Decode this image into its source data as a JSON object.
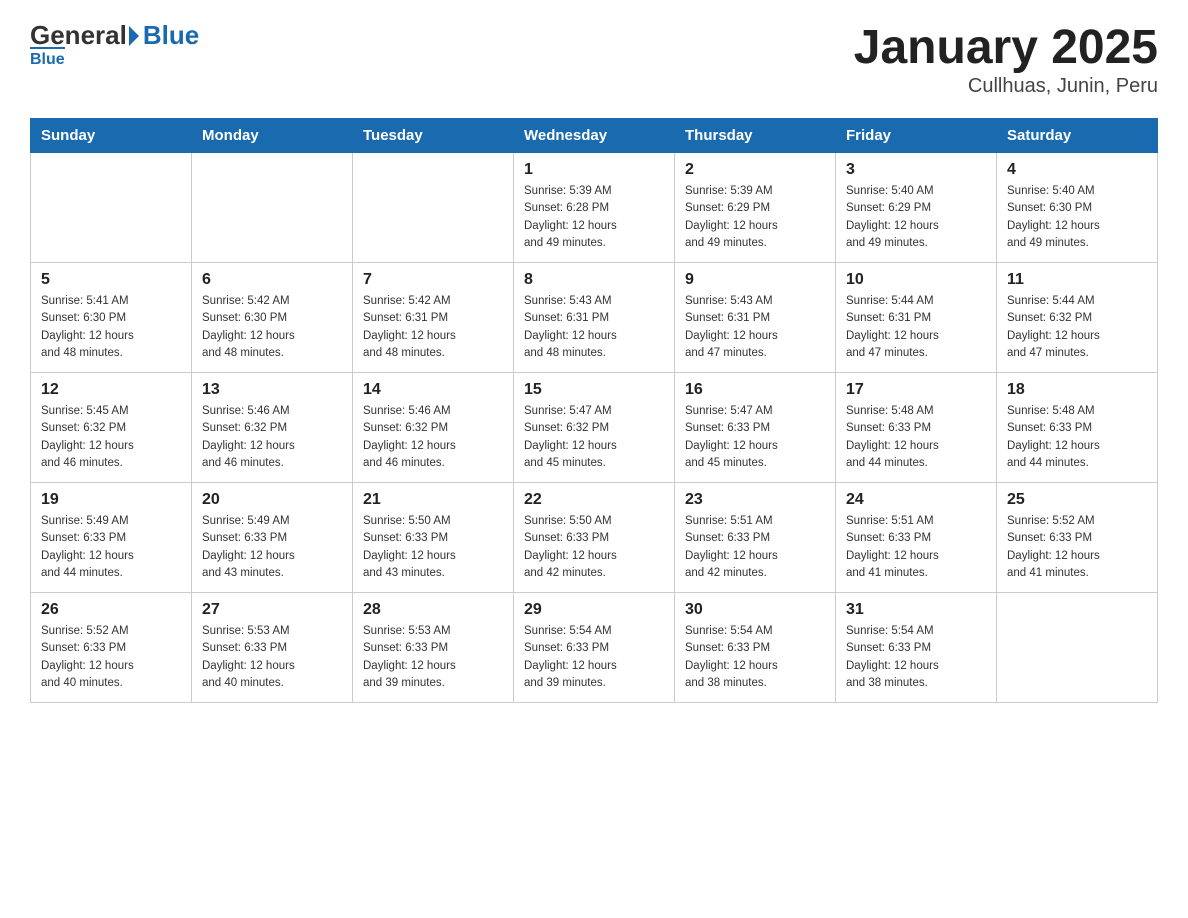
{
  "header": {
    "title": "January 2025",
    "subtitle": "Cullhuas, Junin, Peru",
    "logo_general": "General",
    "logo_blue": "Blue"
  },
  "days_of_week": [
    "Sunday",
    "Monday",
    "Tuesday",
    "Wednesday",
    "Thursday",
    "Friday",
    "Saturday"
  ],
  "weeks": [
    [
      {
        "day": "",
        "info": ""
      },
      {
        "day": "",
        "info": ""
      },
      {
        "day": "",
        "info": ""
      },
      {
        "day": "1",
        "info": "Sunrise: 5:39 AM\nSunset: 6:28 PM\nDaylight: 12 hours\nand 49 minutes."
      },
      {
        "day": "2",
        "info": "Sunrise: 5:39 AM\nSunset: 6:29 PM\nDaylight: 12 hours\nand 49 minutes."
      },
      {
        "day": "3",
        "info": "Sunrise: 5:40 AM\nSunset: 6:29 PM\nDaylight: 12 hours\nand 49 minutes."
      },
      {
        "day": "4",
        "info": "Sunrise: 5:40 AM\nSunset: 6:30 PM\nDaylight: 12 hours\nand 49 minutes."
      }
    ],
    [
      {
        "day": "5",
        "info": "Sunrise: 5:41 AM\nSunset: 6:30 PM\nDaylight: 12 hours\nand 48 minutes."
      },
      {
        "day": "6",
        "info": "Sunrise: 5:42 AM\nSunset: 6:30 PM\nDaylight: 12 hours\nand 48 minutes."
      },
      {
        "day": "7",
        "info": "Sunrise: 5:42 AM\nSunset: 6:31 PM\nDaylight: 12 hours\nand 48 minutes."
      },
      {
        "day": "8",
        "info": "Sunrise: 5:43 AM\nSunset: 6:31 PM\nDaylight: 12 hours\nand 48 minutes."
      },
      {
        "day": "9",
        "info": "Sunrise: 5:43 AM\nSunset: 6:31 PM\nDaylight: 12 hours\nand 47 minutes."
      },
      {
        "day": "10",
        "info": "Sunrise: 5:44 AM\nSunset: 6:31 PM\nDaylight: 12 hours\nand 47 minutes."
      },
      {
        "day": "11",
        "info": "Sunrise: 5:44 AM\nSunset: 6:32 PM\nDaylight: 12 hours\nand 47 minutes."
      }
    ],
    [
      {
        "day": "12",
        "info": "Sunrise: 5:45 AM\nSunset: 6:32 PM\nDaylight: 12 hours\nand 46 minutes."
      },
      {
        "day": "13",
        "info": "Sunrise: 5:46 AM\nSunset: 6:32 PM\nDaylight: 12 hours\nand 46 minutes."
      },
      {
        "day": "14",
        "info": "Sunrise: 5:46 AM\nSunset: 6:32 PM\nDaylight: 12 hours\nand 46 minutes."
      },
      {
        "day": "15",
        "info": "Sunrise: 5:47 AM\nSunset: 6:32 PM\nDaylight: 12 hours\nand 45 minutes."
      },
      {
        "day": "16",
        "info": "Sunrise: 5:47 AM\nSunset: 6:33 PM\nDaylight: 12 hours\nand 45 minutes."
      },
      {
        "day": "17",
        "info": "Sunrise: 5:48 AM\nSunset: 6:33 PM\nDaylight: 12 hours\nand 44 minutes."
      },
      {
        "day": "18",
        "info": "Sunrise: 5:48 AM\nSunset: 6:33 PM\nDaylight: 12 hours\nand 44 minutes."
      }
    ],
    [
      {
        "day": "19",
        "info": "Sunrise: 5:49 AM\nSunset: 6:33 PM\nDaylight: 12 hours\nand 44 minutes."
      },
      {
        "day": "20",
        "info": "Sunrise: 5:49 AM\nSunset: 6:33 PM\nDaylight: 12 hours\nand 43 minutes."
      },
      {
        "day": "21",
        "info": "Sunrise: 5:50 AM\nSunset: 6:33 PM\nDaylight: 12 hours\nand 43 minutes."
      },
      {
        "day": "22",
        "info": "Sunrise: 5:50 AM\nSunset: 6:33 PM\nDaylight: 12 hours\nand 42 minutes."
      },
      {
        "day": "23",
        "info": "Sunrise: 5:51 AM\nSunset: 6:33 PM\nDaylight: 12 hours\nand 42 minutes."
      },
      {
        "day": "24",
        "info": "Sunrise: 5:51 AM\nSunset: 6:33 PM\nDaylight: 12 hours\nand 41 minutes."
      },
      {
        "day": "25",
        "info": "Sunrise: 5:52 AM\nSunset: 6:33 PM\nDaylight: 12 hours\nand 41 minutes."
      }
    ],
    [
      {
        "day": "26",
        "info": "Sunrise: 5:52 AM\nSunset: 6:33 PM\nDaylight: 12 hours\nand 40 minutes."
      },
      {
        "day": "27",
        "info": "Sunrise: 5:53 AM\nSunset: 6:33 PM\nDaylight: 12 hours\nand 40 minutes."
      },
      {
        "day": "28",
        "info": "Sunrise: 5:53 AM\nSunset: 6:33 PM\nDaylight: 12 hours\nand 39 minutes."
      },
      {
        "day": "29",
        "info": "Sunrise: 5:54 AM\nSunset: 6:33 PM\nDaylight: 12 hours\nand 39 minutes."
      },
      {
        "day": "30",
        "info": "Sunrise: 5:54 AM\nSunset: 6:33 PM\nDaylight: 12 hours\nand 38 minutes."
      },
      {
        "day": "31",
        "info": "Sunrise: 5:54 AM\nSunset: 6:33 PM\nDaylight: 12 hours\nand 38 minutes."
      },
      {
        "day": "",
        "info": ""
      }
    ]
  ]
}
